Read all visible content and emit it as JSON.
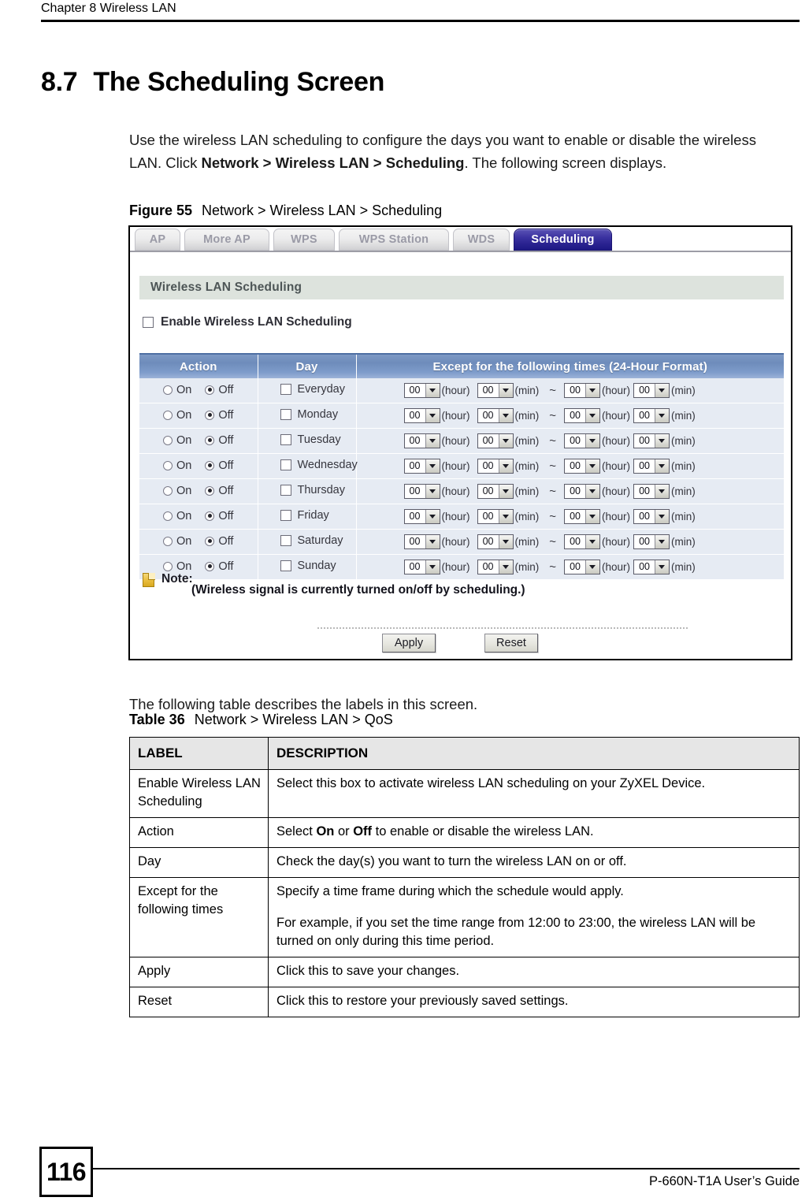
{
  "page": {
    "running_header": "Chapter 8 Wireless LAN",
    "page_number": "116",
    "footer_text": "P-660N-T1A User’s Guide"
  },
  "section": {
    "number": "8.7",
    "title": "The Scheduling Screen",
    "intro_before": "Use the wireless LAN scheduling to configure the days you want to enable or disable the wireless LAN. Click ",
    "intro_bold": "Network > Wireless LAN > Scheduling",
    "intro_after": ". The following screen displays."
  },
  "figure": {
    "caption_label": "Figure 55",
    "caption_text": "Network > Wireless LAN > Scheduling",
    "tabs": [
      {
        "label": "AP",
        "active": false
      },
      {
        "label": "More AP",
        "active": false
      },
      {
        "label": "WPS",
        "active": false
      },
      {
        "label": "WPS Station",
        "active": false
      },
      {
        "label": "WDS",
        "active": false
      },
      {
        "label": "Scheduling",
        "active": true
      }
    ],
    "section_title": "Wireless LAN Scheduling",
    "enable_checkbox_label": "Enable Wireless LAN Scheduling",
    "enable_checkbox_checked": false,
    "table_headers": [
      "Action",
      "Day",
      "Except for the following times   (24-Hour Format)"
    ],
    "radio_on_label": "On",
    "radio_off_label": "Off",
    "unit_hour": "(hour)",
    "unit_min": "(min)",
    "range_separator": "~",
    "rows": [
      {
        "day": "Everyday",
        "action": "Off",
        "day_checked": false,
        "start_hour": "00",
        "start_min": "00",
        "end_hour": "00",
        "end_min": "00"
      },
      {
        "day": "Monday",
        "action": "Off",
        "day_checked": false,
        "start_hour": "00",
        "start_min": "00",
        "end_hour": "00",
        "end_min": "00"
      },
      {
        "day": "Tuesday",
        "action": "Off",
        "day_checked": false,
        "start_hour": "00",
        "start_min": "00",
        "end_hour": "00",
        "end_min": "00"
      },
      {
        "day": "Wednesday",
        "action": "Off",
        "day_checked": false,
        "start_hour": "00",
        "start_min": "00",
        "end_hour": "00",
        "end_min": "00"
      },
      {
        "day": "Thursday",
        "action": "Off",
        "day_checked": false,
        "start_hour": "00",
        "start_min": "00",
        "end_hour": "00",
        "end_min": "00"
      },
      {
        "day": "Friday",
        "action": "Off",
        "day_checked": false,
        "start_hour": "00",
        "start_min": "00",
        "end_hour": "00",
        "end_min": "00"
      },
      {
        "day": "Saturday",
        "action": "Off",
        "day_checked": false,
        "start_hour": "00",
        "start_min": "00",
        "end_hour": "00",
        "end_min": "00"
      },
      {
        "day": "Sunday",
        "action": "Off",
        "day_checked": false,
        "start_hour": "00",
        "start_min": "00",
        "end_hour": "00",
        "end_min": "00"
      }
    ],
    "note_label": "Note:",
    "note_text": "(Wireless signal is currently turned on/off by scheduling.)",
    "apply_button": "Apply",
    "reset_button": "Reset"
  },
  "following_text": "The following table describes the labels in this screen.",
  "table36": {
    "caption_label": "Table 36",
    "caption_text": "Network > Wireless LAN > QoS",
    "headers": {
      "label": "LABEL",
      "description": "DESCRIPTION"
    },
    "rows": [
      {
        "label": "Enable Wireless LAN Scheduling",
        "desc_1_pre": "Select this box to activate wireless LAN scheduling on your ZyXEL Device.",
        "desc_1_bold": "",
        "desc_1_mid": "",
        "desc_1_bold2": "",
        "desc_1_post": "",
        "desc_2": ""
      },
      {
        "label": "Action",
        "desc_1_pre": "Select ",
        "desc_1_bold": "On",
        "desc_1_mid": " or ",
        "desc_1_bold2": "Off",
        "desc_1_post": " to enable or disable the wireless LAN.",
        "desc_2": ""
      },
      {
        "label": "Day",
        "desc_1_pre": "Check the day(s) you want to turn the wireless LAN on or off.",
        "desc_1_bold": "",
        "desc_1_mid": "",
        "desc_1_bold2": "",
        "desc_1_post": "",
        "desc_2": ""
      },
      {
        "label": "Except for the following times",
        "desc_1_pre": "Specify a time frame during which the schedule would apply.",
        "desc_1_bold": "",
        "desc_1_mid": "",
        "desc_1_bold2": "",
        "desc_1_post": "",
        "desc_2": "For example, if you set the time range from 12:00 to 23:00, the wireless LAN will be turned on only during this time period."
      },
      {
        "label": "Apply",
        "desc_1_pre": "Click this to save your changes.",
        "desc_1_bold": "",
        "desc_1_mid": "",
        "desc_1_bold2": "",
        "desc_1_post": "",
        "desc_2": ""
      },
      {
        "label": "Reset",
        "desc_1_pre": "Click this to restore your previously saved settings.",
        "desc_1_bold": "",
        "desc_1_mid": "",
        "desc_1_bold2": "",
        "desc_1_post": "",
        "desc_2": ""
      }
    ]
  },
  "colors": {
    "active_tab": "#2a2391",
    "table_header_blue": "#7894c2",
    "row_blue": "#e6ebf3",
    "section_bar": "#dde3dd",
    "desc_header_gray": "#e6e6e6"
  }
}
